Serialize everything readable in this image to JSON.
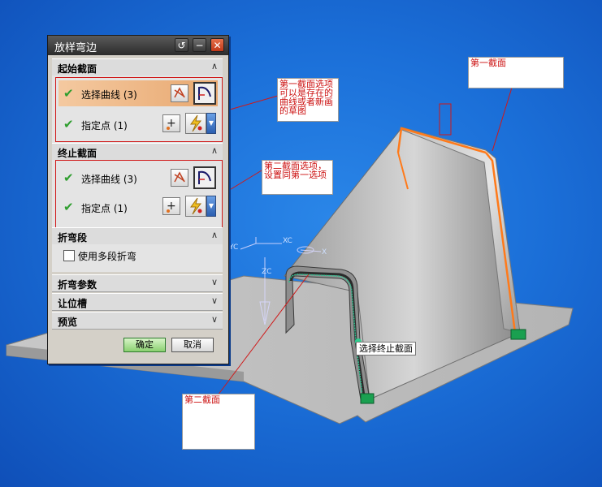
{
  "dialog": {
    "title": "放样弯边",
    "sections": {
      "start": {
        "title": "起始截面",
        "toggle": "∧",
        "rows": [
          {
            "label": "选择曲线 (3)",
            "icon": "check-icon"
          },
          {
            "label": "指定点 (1)",
            "icon": "check-icon"
          }
        ]
      },
      "end": {
        "title": "终止截面",
        "toggle": "∧",
        "rows": [
          {
            "label": "选择曲线 (3)",
            "icon": "check-icon"
          },
          {
            "label": "指定点 (1)",
            "icon": "check-icon"
          }
        ]
      },
      "bend_segment": {
        "title": "折弯段",
        "toggle": "∧",
        "checkbox_label": "使用多段折弯"
      },
      "bend_params": {
        "title": "折弯参数",
        "toggle": "∨"
      },
      "relief": {
        "title": "让位槽",
        "toggle": "∨"
      },
      "preview": {
        "title": "预览",
        "toggle": "∨"
      }
    },
    "ok_label": "确定",
    "cancel_label": "取消"
  },
  "annotations": {
    "first_section_option": "第一截面选项可以是存在的曲线或者新画的草图",
    "second_section_option": "第二截面选项，设置同第一选项",
    "first_section": "第一截面",
    "second_section": "第二截面",
    "select_end_section": "选择终止截面"
  },
  "axis_labels": {
    "xc": "XC",
    "zc": "ZC",
    "yc": "YC",
    "x": "X"
  },
  "colors": {
    "background": "#1b6fd8",
    "curve_highlight": "#ff7a1a",
    "annotation_text": "#cc1010",
    "check": "#2e9e2e"
  }
}
